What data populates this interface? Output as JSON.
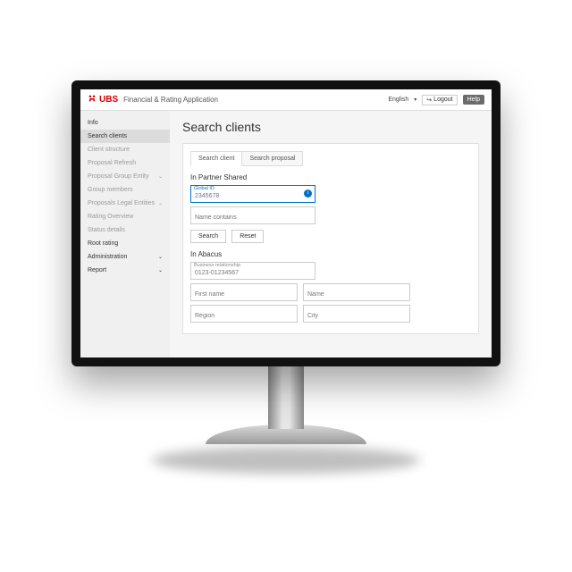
{
  "header": {
    "brand": "UBS",
    "app_title": "Financial & Rating Application",
    "language": "English",
    "logout": "Logout",
    "help": "Help"
  },
  "sidebar": {
    "items": [
      {
        "label": "Info",
        "enabled": true,
        "active": false,
        "expandable": false
      },
      {
        "label": "Search clients",
        "enabled": true,
        "active": true,
        "expandable": false
      },
      {
        "label": "Client structure",
        "enabled": false,
        "active": false,
        "expandable": false
      },
      {
        "label": "Proposal Refresh",
        "enabled": false,
        "active": false,
        "expandable": false
      },
      {
        "label": "Proposal Group Entity",
        "enabled": false,
        "active": false,
        "expandable": true
      },
      {
        "label": "Group members",
        "enabled": false,
        "active": false,
        "expandable": false
      },
      {
        "label": "Proposals Legal Entities",
        "enabled": false,
        "active": false,
        "expandable": true
      },
      {
        "label": "Rating Overview",
        "enabled": false,
        "active": false,
        "expandable": false
      },
      {
        "label": "Status details",
        "enabled": false,
        "active": false,
        "expandable": false
      },
      {
        "label": "Root rating",
        "enabled": true,
        "active": false,
        "expandable": false
      },
      {
        "label": "Administration",
        "enabled": true,
        "active": false,
        "expandable": true
      },
      {
        "label": "Report",
        "enabled": true,
        "active": false,
        "expandable": true
      }
    ]
  },
  "main": {
    "title": "Search clients",
    "tabs": [
      {
        "label": "Search client",
        "active": true
      },
      {
        "label": "Search proposal",
        "active": false
      }
    ],
    "partner_shared": {
      "heading": "In Partner Shared",
      "global_id": {
        "label": "Global ID",
        "placeholder": "2345678",
        "value": ""
      },
      "name_contains": {
        "placeholder": "Name contains",
        "value": ""
      },
      "search_btn": "Search",
      "reset_btn": "Reset"
    },
    "abacus": {
      "heading": "In Abacus",
      "business_rel": {
        "label": "Business relationship",
        "placeholder": "0123-01234567",
        "value": ""
      },
      "first_name": {
        "placeholder": "First name",
        "value": ""
      },
      "name": {
        "placeholder": "Name",
        "value": ""
      },
      "region": {
        "placeholder": "Region",
        "value": ""
      },
      "city": {
        "placeholder": "City",
        "value": ""
      }
    }
  }
}
